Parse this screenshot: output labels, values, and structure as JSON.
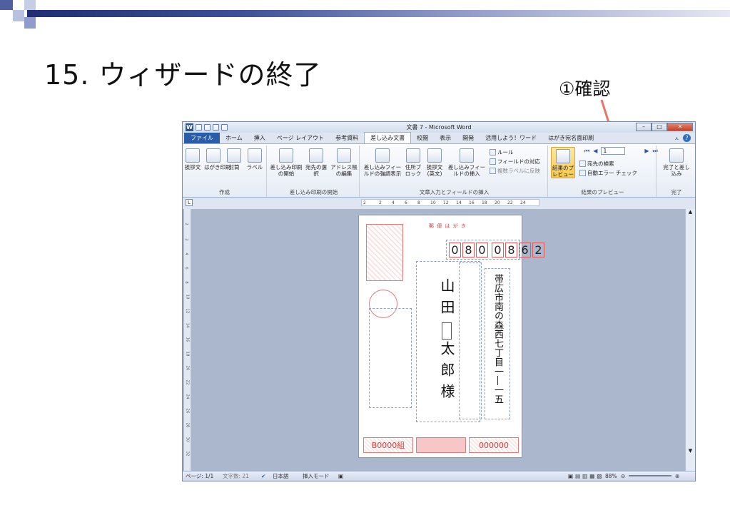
{
  "slide": {
    "title": "15. ウィザードの終了",
    "callout": "①確認"
  },
  "window": {
    "title": "文書 7 - Microsoft Word",
    "app_icon": "W",
    "tabs": [
      "ファイル",
      "ホーム",
      "挿入",
      "ページ レイアウト",
      "参考資料",
      "差し込み文書",
      "校閲",
      "表示",
      "開発",
      "活用しよう！ワード",
      "はがき宛名面印刷"
    ],
    "active_tab": "差し込み文書"
  },
  "ribbon": {
    "group1": {
      "label": "作成",
      "buttons": [
        "挨拶文",
        "はがき印刷",
        "封筒",
        "ラベル"
      ]
    },
    "group2": {
      "label": "差し込み印刷の開始",
      "buttons": [
        "差し込み印刷の開始",
        "宛先の選択",
        "アドレス帳の編集"
      ]
    },
    "group3": {
      "label": "文章入力とフィールドの挿入",
      "buttons": [
        "差し込みフィールドの強調表示",
        "住所ブロック",
        "挨拶文(英文)",
        "差し込みフィールドの挿入"
      ],
      "small": [
        "ルール",
        "フィールドの対応",
        "複数ラベルに反映"
      ]
    },
    "group4": {
      "label": "結果のプレビュー",
      "preview": "結果のプレビュー",
      "small": [
        "宛先の検索",
        "自動エラー チェック"
      ],
      "record": "1"
    },
    "group5": {
      "label": "完了",
      "buttons": [
        "完了と差し込み"
      ]
    }
  },
  "ruler": {
    "ticks": [
      "2",
      "2",
      "4",
      "6",
      "8",
      "10",
      "12",
      "14",
      "16",
      "18",
      "20",
      "22",
      "24"
    ]
  },
  "vruler": {
    "ticks": [
      "2",
      "2",
      "4",
      "6",
      "8",
      "10",
      "12",
      "14",
      "16",
      "18",
      "20",
      "22",
      "24",
      "26",
      "28",
      "30",
      "32"
    ]
  },
  "postcard": {
    "heading": "郵 便 は が き",
    "zip": [
      "0",
      "8",
      "0",
      "0",
      "8",
      "6",
      "2"
    ],
    "address": "帯広市南の森西七丁目一―一五",
    "name": [
      "山",
      "田",
      "",
      "太",
      "郎",
      "様"
    ],
    "footer": [
      "B0000組",
      "000000"
    ]
  },
  "status": {
    "page": "ページ: 1/1",
    "words": "文字数: 21",
    "lang": "日本語",
    "mode": "挿入モード",
    "zoom": "88%"
  },
  "colors": {
    "accent": "#2a5ca8",
    "arrow": "#e0524a",
    "stamp": "#d34040"
  }
}
